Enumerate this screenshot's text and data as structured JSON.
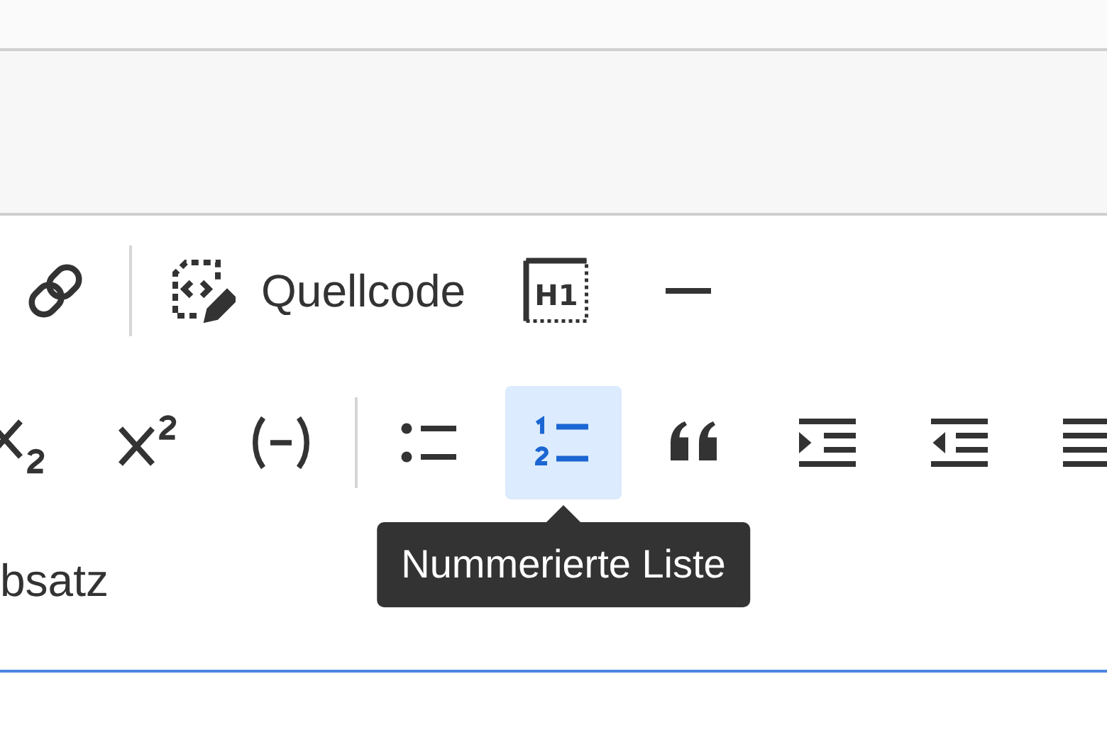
{
  "toolbar": {
    "rows": [
      {
        "items": [
          {
            "kind": "link",
            "on": false
          },
          {
            "kind": "separator"
          },
          {
            "kind": "source",
            "label": "Quellcode",
            "on": false
          },
          {
            "kind": "heading",
            "glyph": "H1",
            "on": false
          },
          {
            "kind": "hr",
            "on": false
          }
        ]
      },
      {
        "items": [
          {
            "kind": "subscript",
            "on": false
          },
          {
            "kind": "superscript",
            "on": false
          },
          {
            "kind": "special",
            "on": false
          },
          {
            "kind": "separator"
          },
          {
            "kind": "bulleted",
            "on": false
          },
          {
            "kind": "numbered",
            "on": true,
            "tooltip": "Nummerierte Liste"
          },
          {
            "kind": "quote",
            "on": false
          },
          {
            "kind": "indent",
            "on": false
          },
          {
            "kind": "outdent",
            "on": false
          },
          {
            "kind": "align",
            "on": false
          }
        ]
      }
    ]
  },
  "paragraph": {
    "label": "bsatz"
  }
}
